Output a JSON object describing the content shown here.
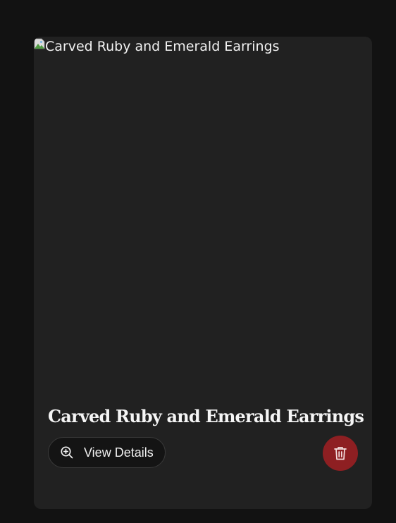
{
  "product": {
    "image_alt": "Carved Ruby and Emerald Earrings",
    "title": "Carved Ruby and Emerald Earrings"
  },
  "actions": {
    "view_label": "View Details",
    "view_icon": "zoom-in-icon",
    "delete_icon": "trash-icon"
  },
  "colors": {
    "page_background": "#121212",
    "card_background": "#212121",
    "delete_button": "#8e1f22"
  }
}
